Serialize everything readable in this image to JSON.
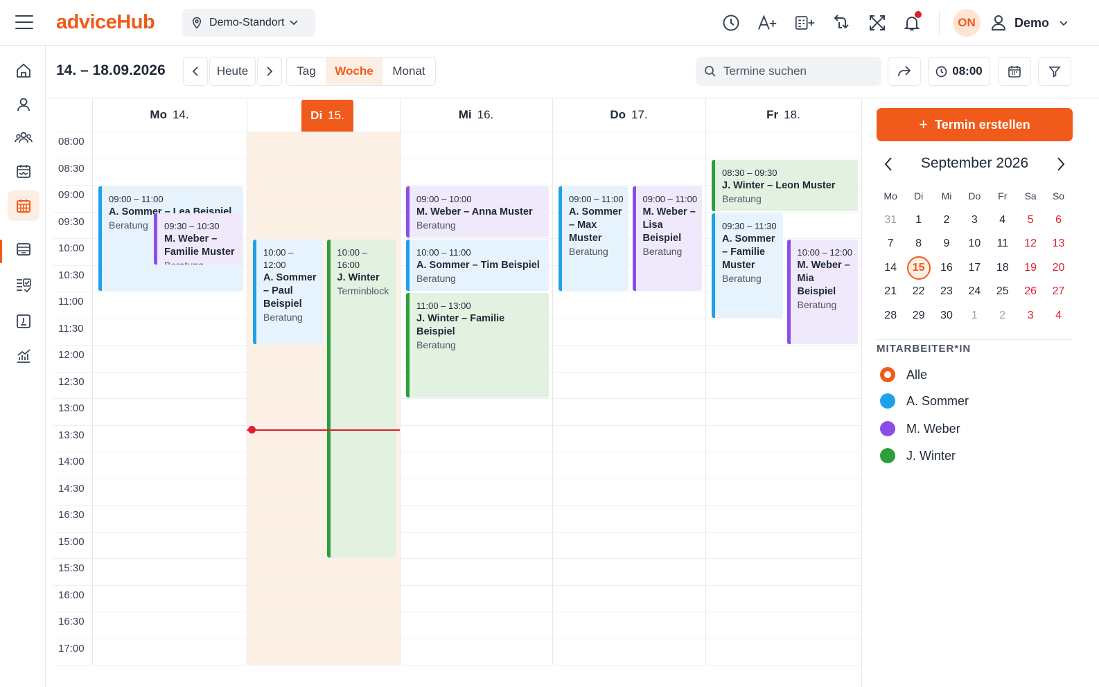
{
  "app": {
    "logo": "adviceHub",
    "location": "Demo-Standort",
    "avatar_initials": "ON",
    "user_name": "Demo",
    "accent_color": "#f05a1a",
    "icons": [
      "clock-icon",
      "text-size-icon",
      "add-form-icon",
      "sync-icon",
      "fullscreen-icon",
      "bell-icon"
    ]
  },
  "sidebar": {
    "items": [
      "home",
      "contacts",
      "groups",
      "inbox",
      "calendar",
      "archive",
      "tasks",
      "dashboard",
      "analytics"
    ],
    "active": "calendar"
  },
  "toolbar": {
    "range": "14. – 18.09.2026",
    "today_label": "Heute",
    "views": [
      "Tag",
      "Woche",
      "Monat"
    ],
    "active_view": "Woche",
    "search_placeholder": "Termine suchen",
    "time_label": "08:00"
  },
  "week": {
    "days": [
      {
        "wd": "Mo",
        "num": "14."
      },
      {
        "wd": "Di",
        "num": "15."
      },
      {
        "wd": "Mi",
        "num": "16."
      },
      {
        "wd": "Do",
        "num": "17."
      },
      {
        "wd": "Fr",
        "num": "18."
      }
    ],
    "today_index": 1,
    "times": [
      "08:00",
      "08:30",
      "09:00",
      "09:30",
      "10:00",
      "10:30",
      "11:00",
      "11:30",
      "12:00",
      "12:30",
      "13:00",
      "13:30",
      "14:00",
      "14:30",
      "16:30",
      "15:00",
      "15:30",
      "16:00",
      "16:30",
      "17:00"
    ],
    "now_time": "13:30"
  },
  "events": [
    {
      "day": 0,
      "start": 9.0,
      "end": 11.0,
      "col": 0,
      "cols": 1,
      "color": "blue",
      "time": "09:00 – 11:00",
      "name": "A. Sommer – Lea Beispiel",
      "kind": "Beratung"
    },
    {
      "day": 0,
      "start": 9.5,
      "end": 10.5,
      "col": 1,
      "cols": 2,
      "color": "purple",
      "time": "09:30 – 10:30",
      "name": "M. Weber – Familie Muster",
      "kind": "Beratung"
    },
    {
      "day": 1,
      "start": 10.0,
      "end": 12.0,
      "col": 0,
      "cols": 2,
      "color": "blue",
      "time": "10:00 – 12:00",
      "name": "A. Sommer – Paul Beispiel",
      "kind": "Beratung"
    },
    {
      "day": 1,
      "start": 10.0,
      "end": 16.0,
      "col": 1,
      "cols": 2,
      "color": "green",
      "time": "10:00 – 16:00",
      "name": "J. Winter",
      "kind": "Terminblock"
    },
    {
      "day": 2,
      "start": 9.0,
      "end": 10.0,
      "col": 0,
      "cols": 1,
      "color": "purple",
      "time": "09:00 – 10:00",
      "name": "M. Weber – Anna Muster",
      "kind": "Beratung"
    },
    {
      "day": 2,
      "start": 10.0,
      "end": 11.0,
      "col": 0,
      "cols": 1,
      "color": "blue",
      "time": "10:00 – 11:00",
      "name": "A. Sommer – Tim Beispiel",
      "kind": "Beratung"
    },
    {
      "day": 2,
      "start": 11.0,
      "end": 13.0,
      "col": 0,
      "cols": 1,
      "color": "green",
      "time": "11:00 – 13:00",
      "name": "J. Winter – Familie Beispiel",
      "kind": "Beratung"
    },
    {
      "day": 3,
      "start": 9.0,
      "end": 11.0,
      "col": 0,
      "cols": 2,
      "color": "blue",
      "time": "09:00 – 11:00",
      "name": "A. Sommer – Max Muster",
      "kind": "Beratung"
    },
    {
      "day": 3,
      "start": 9.0,
      "end": 11.0,
      "col": 1,
      "cols": 2,
      "color": "purple",
      "time": "09:00 – 11:00",
      "name": "M. Weber – Lisa Beispiel",
      "kind": "Beratung"
    },
    {
      "day": 4,
      "start": 8.5,
      "end": 9.5,
      "col": 0,
      "cols": 1,
      "color": "green",
      "time": "08:30 – 09:30",
      "name": "J. Winter – Leon Muster",
      "kind": "Beratung"
    },
    {
      "day": 4,
      "start": 9.5,
      "end": 11.5,
      "col": 0,
      "cols": 2,
      "color": "blue",
      "time": "09:30 – 11:30",
      "name": "A. Sommer – Familie Muster",
      "kind": "Beratung"
    },
    {
      "day": 4,
      "start": 10.0,
      "end": 12.0,
      "col": 1,
      "cols": 2,
      "color": "purple",
      "time": "10:00 – 12:00",
      "name": "M. Weber – Mia Beispiel",
      "kind": "Beratung"
    }
  ],
  "right": {
    "create_label": "Termin erstellen",
    "month_title": "September 2026",
    "weekdays": [
      "Mo",
      "Di",
      "Mi",
      "Do",
      "Fr",
      "Sa",
      "So"
    ],
    "weeks": [
      [
        "31",
        "1",
        "2",
        "3",
        "4",
        "5",
        "6"
      ],
      [
        "7",
        "8",
        "9",
        "10",
        "11",
        "12",
        "13"
      ],
      [
        "14",
        "15",
        "16",
        "17",
        "18",
        "19",
        "20"
      ],
      [
        "21",
        "22",
        "23",
        "24",
        "25",
        "26",
        "27"
      ],
      [
        "28",
        "29",
        "30",
        "1",
        "2",
        "3",
        "4"
      ]
    ],
    "selected_day": "15",
    "employees_title": "MITARBEITER*IN",
    "employees": [
      {
        "name": "Alle",
        "color": "#f05a1a"
      },
      {
        "name": "A. Sommer",
        "color": "#1ea1e8"
      },
      {
        "name": "M. Weber",
        "color": "#8a4ee8"
      },
      {
        "name": "J. Winter",
        "color": "#2e9e3a"
      }
    ]
  }
}
